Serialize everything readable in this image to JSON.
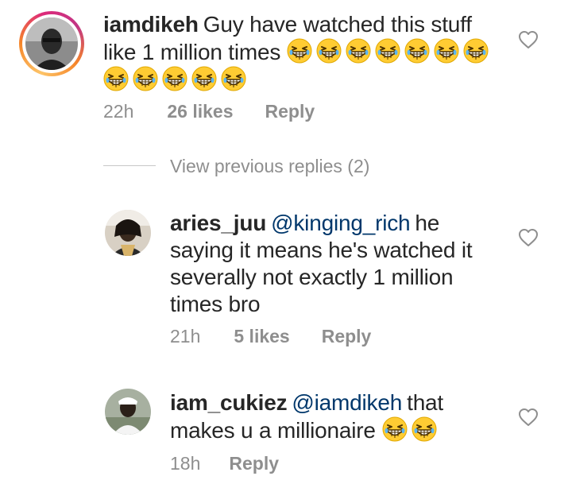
{
  "comments": [
    {
      "username": "iamdikeh",
      "mention": "",
      "text_line1": "Guy have watched this stuff",
      "text_line2": "like 1 million times",
      "time": "22h",
      "likes": "26 likes",
      "reply": "Reply",
      "emoji_count_line2": 7,
      "emoji_count_line3": 5
    }
  ],
  "view_previous": "View previous replies (2)",
  "replies": [
    {
      "username": "aries_juu",
      "mention": "@kinging_rich",
      "text_line1": "he",
      "text_line2": "saying it means he's watched it",
      "text_line3": "severally not exactly 1 million",
      "text_line4": "times bro",
      "time": "21h",
      "likes": "5 likes",
      "reply": "Reply"
    },
    {
      "username": "iam_cukiez",
      "mention": "@iamdikeh",
      "text_line1": "that",
      "text_line2": "makes u a millionaire",
      "time": "18h",
      "reply": "Reply",
      "emoji_count": 2
    }
  ],
  "icons": {
    "like": "heart-outline-icon",
    "emoji": "grinning-squinting-face-emoji"
  },
  "colors": {
    "text": "#262626",
    "meta": "#8e8e8e",
    "mention": "#00376b",
    "story_ring": [
      "#fdc468",
      "#f58529",
      "#dd2a7b"
    ]
  }
}
